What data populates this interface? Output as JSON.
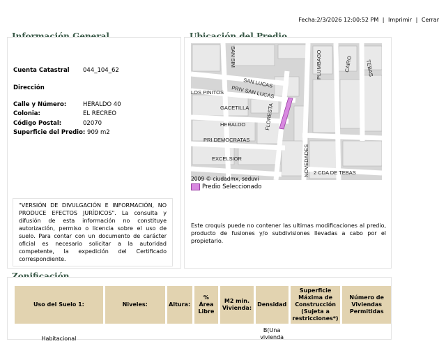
{
  "header": {
    "fecha": "Fecha:2/3/2026 12:00:52 PM",
    "imprimir": "Imprimir",
    "cerrar": "Cerrar"
  },
  "info_general": {
    "title": "Información General",
    "cuenta_label": "Cuenta Catastral",
    "cuenta_value": "044_104_62",
    "direccion_label": "Dirección",
    "calle_label": "Calle y Número:",
    "calle_value": "HERALDO 40",
    "colonia_label": "Colonia:",
    "colonia_value": "EL RECREO",
    "cp_label": "Código Postal:",
    "cp_value": "02070",
    "superficie_label": "Superficie del Predio:",
    "superficie_value": "909 m2",
    "disclaimer_1": "\"VERSIÓN DE DIVULGACIÓN E INFORMACIÓN, NO PRODUCE EFECTOS JURÍDICOS\".",
    "disclaimer_2": "La consulta y difusión de esta información no constituye autorización, permiso o licencia sobre el uso de suelo. Para contar con un documento de carácter oficial es necesario solicitar a la autoridad competente, la expedición del Certificado correspondiente."
  },
  "ubicacion": {
    "title": "Ubicación del Predio",
    "copyright": "2009 © ciudadmx, seduvi",
    "legend_label": "Predio Seleccionado",
    "note": "Este croquis puede no contener las ultimas modificaciones al predio, producto de fusiones y/o subdivisiones llevadas a cabo por el propietario.",
    "streets": {
      "san_simon": "SAN SIM",
      "san_lucas": "SAN LUCAS",
      "priv_san_lucas": "PRIV SAN LUCAS",
      "los_pinitos": "LOS PINITOS",
      "gacetilla": "GACETILLA",
      "heraldo": "HERALDO",
      "floresta": "FLORESTA",
      "pri_democratas": "PRI DEMOCRATAS",
      "excelsior": "EXCELSIOR",
      "plumbago": "PLUMBAGO",
      "cairo": "CAIRO",
      "tebas": "TEBAS",
      "novedades": "NOVEDADES",
      "cda_tebas": "2 CDA DE TEBAS"
    }
  },
  "zonificacion": {
    "title": "Zonificación",
    "headers": [
      "Uso del Suelo 1:",
      "Niveles:",
      "Altura:",
      "% Área Libre",
      "M2 min. Vivienda:",
      "Densidad",
      "Superficie Máxima de Construcción (Sujeta a restricciones*)",
      "Número de Viviendas Permitidas"
    ],
    "row": [
      "Habitacional",
      "",
      "",
      "",
      "",
      "B(Una vivienda",
      "",
      ""
    ]
  },
  "colors": {
    "heading": "#3a5a48",
    "table_header": "#e2d3b0",
    "predio": "#d888e0"
  }
}
